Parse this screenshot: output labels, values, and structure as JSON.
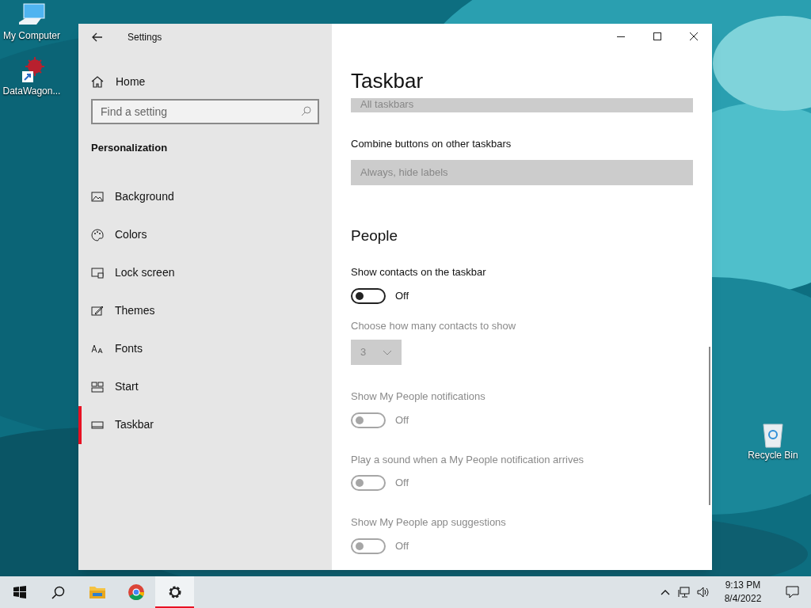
{
  "desktop": {
    "left_icons": [
      {
        "kind": "computer",
        "label": "My Computer"
      },
      {
        "kind": "app",
        "label": "DataWagon..."
      }
    ],
    "right_icons": [
      {
        "kind": "recycle",
        "label": "Recycle Bin"
      }
    ]
  },
  "window": {
    "title": "Settings",
    "home": "Home",
    "search": {
      "placeholder": "Find a setting"
    },
    "section": "Personalization",
    "sidebar": {
      "items": [
        {
          "kind": "background",
          "label": "Background",
          "selected": false
        },
        {
          "kind": "colors",
          "label": "Colors",
          "selected": false
        },
        {
          "kind": "lock",
          "label": "Lock screen",
          "selected": false
        },
        {
          "kind": "themes",
          "label": "Themes",
          "selected": false
        },
        {
          "kind": "fonts",
          "label": "Fonts",
          "selected": false
        },
        {
          "kind": "start",
          "label": "Start",
          "selected": false
        },
        {
          "kind": "taskbar",
          "label": "Taskbar",
          "selected": true
        }
      ]
    },
    "content": {
      "heading": "Taskbar",
      "top_dropdown": {
        "value": "All taskbars",
        "disabled": true
      },
      "combine": {
        "label": "Combine buttons on other taskbars",
        "value": "Always, hide labels",
        "disabled": true
      },
      "people": {
        "heading": "People",
        "settings": [
          {
            "kind": "toggle",
            "label": "Show contacts on the taskbar",
            "on": false,
            "state_label": "Off",
            "disabled": false
          },
          {
            "kind": "dropdown",
            "label": "Choose how many contacts to show",
            "value": "3",
            "disabled": true
          },
          {
            "kind": "toggle",
            "label": "Show My People notifications",
            "on": false,
            "state_label": "Off",
            "disabled": true
          },
          {
            "kind": "toggle",
            "label": "Play a sound when a My People notification arrives",
            "on": false,
            "state_label": "Off",
            "disabled": true
          },
          {
            "kind": "toggle",
            "label": "Show My People app suggestions",
            "on": false,
            "state_label": "Off",
            "disabled": true
          }
        ]
      }
    }
  },
  "taskbar": {
    "items": [
      {
        "kind": "start",
        "selected": false
      },
      {
        "kind": "search",
        "selected": false
      },
      {
        "kind": "explorer",
        "selected": false
      },
      {
        "kind": "chrome",
        "selected": false
      },
      {
        "kind": "settings",
        "selected": true
      }
    ],
    "time": "9:13 PM",
    "date": "8/4/2022"
  }
}
